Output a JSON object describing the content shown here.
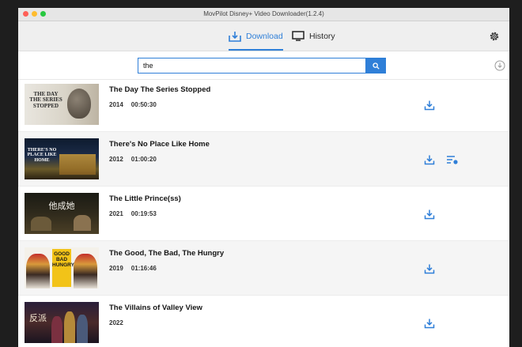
{
  "window": {
    "title": "MovPilot Disney+ Video Downloader(1.2.4)"
  },
  "tabs": [
    {
      "label": "Download",
      "active": true,
      "icon": "download-tray-icon"
    },
    {
      "label": "History",
      "active": false,
      "icon": "monitor-icon"
    }
  ],
  "search": {
    "value": "the",
    "button_icon": "search-icon"
  },
  "colors": {
    "accent": "#2f7fd8",
    "window_bg": "#ffffff",
    "toolbar_bg": "#efefef"
  },
  "results": [
    {
      "title": "The Day The Series Stopped",
      "year": "2014",
      "duration": "00:50:30",
      "thumb_text": "THE DAY THE SERIES STOPPED",
      "has_episodes": false
    },
    {
      "title": "There's No Place Like Home",
      "year": "2012",
      "duration": "01:00:20",
      "thumb_text": "THERE'S NO PLACE LIKE HOME",
      "has_episodes": true
    },
    {
      "title": "The Little Prince(ss)",
      "year": "2021",
      "duration": "00:19:53",
      "thumb_text": "他成她",
      "has_episodes": false
    },
    {
      "title": "The Good, The Bad, The Hungry",
      "year": "2019",
      "duration": "01:16:46",
      "thumb_text": "GOOD BAD HUNGRY",
      "has_episodes": false
    },
    {
      "title": "The Villains of Valley View",
      "year": "2022",
      "duration": "",
      "thumb_text": "反派",
      "has_episodes": false
    }
  ]
}
